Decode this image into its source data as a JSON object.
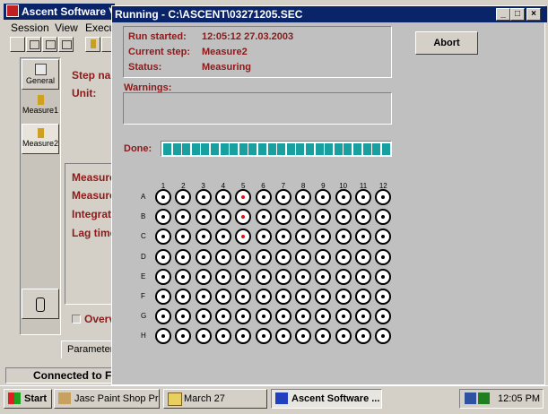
{
  "back_window": {
    "title": "Ascent Software Ve",
    "menu": [
      "Session",
      "View",
      "Execu"
    ],
    "side_items": [
      "General",
      "Measure1",
      "Measure2"
    ],
    "form_labels": [
      "Step nar",
      "Unit:"
    ],
    "detail_labels": [
      "Measure",
      "Measure",
      "Integrati",
      "Lag time"
    ],
    "checkbox_label": "Overv",
    "tab_label": "Parameter",
    "status_text": "Connected to Fl"
  },
  "run_dialog": {
    "title": "Running - C:\\ASCENT\\03271205.SEC",
    "info": [
      {
        "label": "Run started:",
        "value": "12:05:12 27.03.2003"
      },
      {
        "label": "Current step:",
        "value": "Measure2"
      },
      {
        "label": "Status:",
        "value": "Measuring"
      }
    ],
    "abort_label": "Abort",
    "warnings_label": "Warnings:",
    "warnings_text": "",
    "done_label": "Done:",
    "progress_fraction": 1.0,
    "plate": {
      "columns": [
        "1",
        "2",
        "3",
        "4",
        "5",
        "6",
        "7",
        "8",
        "9",
        "10",
        "11",
        "12"
      ],
      "rows": [
        "A",
        "B",
        "C",
        "D",
        "E",
        "F",
        "G",
        "H"
      ],
      "active_wells": [
        "A5",
        "B5",
        "C5"
      ],
      "active_color": "#e01010"
    }
  },
  "taskbar": {
    "start_label": "Start",
    "buttons": [
      {
        "label": "Jasc Paint Shop Pro..."
      },
      {
        "label": "March 27"
      },
      {
        "label": "Ascent Software ..."
      }
    ],
    "clock": "12:05 PM"
  }
}
